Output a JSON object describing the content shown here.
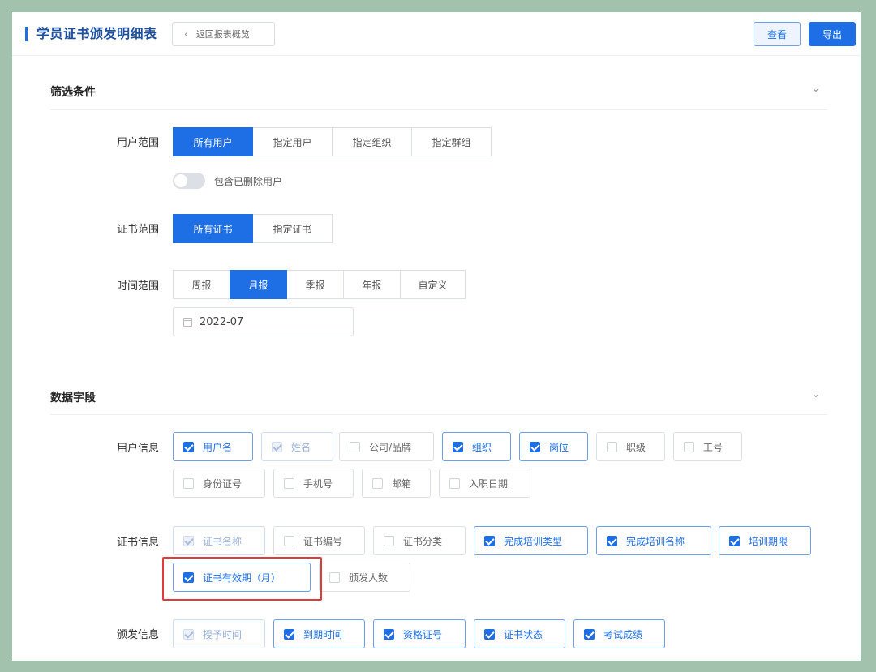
{
  "header": {
    "title": "学员证书颁发明细表",
    "back_label": "返回报表概览",
    "view_label": "查看",
    "export_label": "导出"
  },
  "filters": {
    "section_title": "筛选条件",
    "user_scope": {
      "label": "用户范围",
      "options": [
        "所有用户",
        "指定用户",
        "指定组织",
        "指定群组"
      ],
      "selected": "所有用户"
    },
    "include_deleted": {
      "label": "包含已删除用户",
      "value": false
    },
    "cert_scope": {
      "label": "证书范围",
      "options": [
        "所有证书",
        "指定证书"
      ],
      "selected": "所有证书"
    },
    "time_scope": {
      "label": "时间范围",
      "options": [
        "周报",
        "月报",
        "季报",
        "年报",
        "自定义"
      ],
      "selected": "月报"
    },
    "date_value": "2022-07"
  },
  "fields": {
    "section_title": "数据字段",
    "user_info": {
      "label": "用户信息",
      "items": [
        {
          "label": "用户名",
          "state": "checked"
        },
        {
          "label": "姓名",
          "state": "disabled"
        },
        {
          "label": "公司/品牌",
          "state": "unchecked"
        },
        {
          "label": "组织",
          "state": "checked"
        },
        {
          "label": "岗位",
          "state": "checked"
        },
        {
          "label": "职级",
          "state": "unchecked"
        },
        {
          "label": "工号",
          "state": "unchecked"
        },
        {
          "label": "身份证号",
          "state": "unchecked"
        },
        {
          "label": "手机号",
          "state": "unchecked"
        },
        {
          "label": "邮箱",
          "state": "unchecked"
        },
        {
          "label": "入职日期",
          "state": "unchecked"
        }
      ]
    },
    "cert_info": {
      "label": "证书信息",
      "items": [
        {
          "label": "证书名称",
          "state": "disabled"
        },
        {
          "label": "证书编号",
          "state": "unchecked"
        },
        {
          "label": "证书分类",
          "state": "unchecked"
        },
        {
          "label": "完成培训类型",
          "state": "checked"
        },
        {
          "label": "完成培训名称",
          "state": "checked"
        },
        {
          "label": "培训期限",
          "state": "checked"
        },
        {
          "label": "证书有效期（月）",
          "state": "checked"
        },
        {
          "label": "颁发人数",
          "state": "unchecked"
        }
      ]
    },
    "issue_info": {
      "label": "颁发信息",
      "items": [
        {
          "label": "授予时间",
          "state": "disabled"
        },
        {
          "label": "到期时间",
          "state": "checked"
        },
        {
          "label": "资格证号",
          "state": "checked"
        },
        {
          "label": "证书状态",
          "state": "checked"
        },
        {
          "label": "考试成绩",
          "state": "checked"
        }
      ]
    }
  },
  "colors": {
    "primary": "#1e6fe6",
    "highlight_box": "#e23a3a",
    "background": "#a3c2ad"
  }
}
